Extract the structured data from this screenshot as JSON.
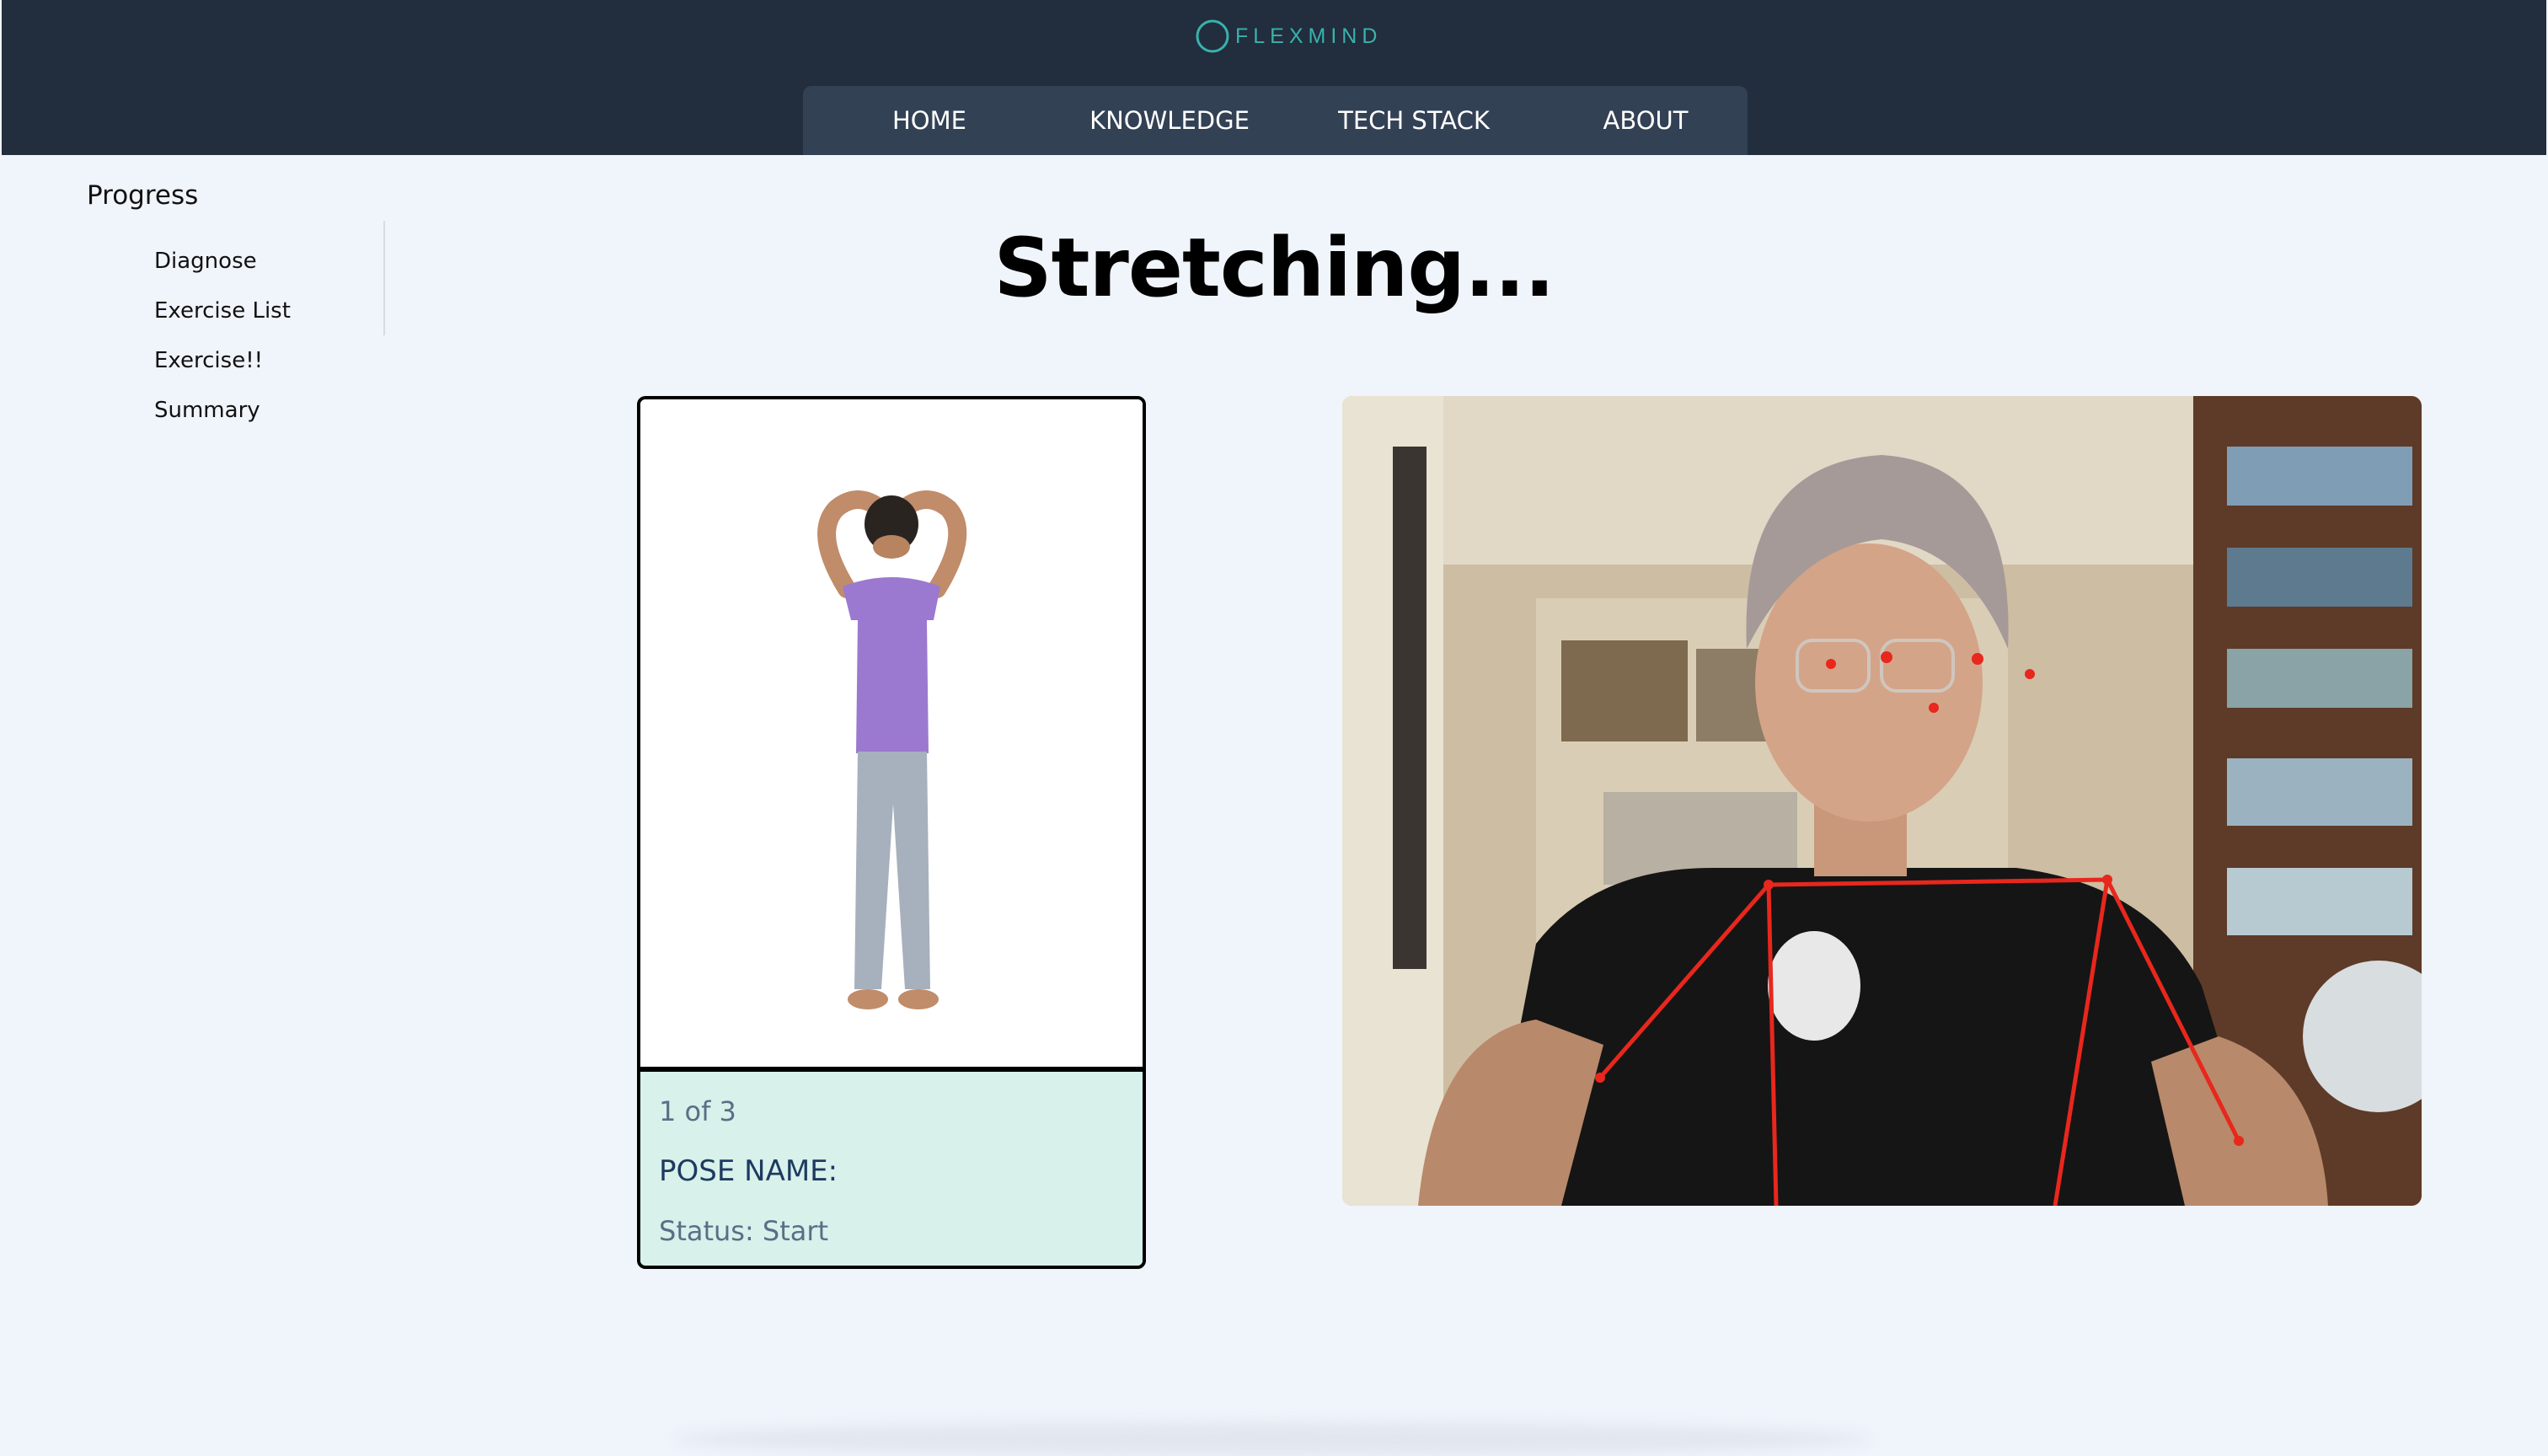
{
  "brand": {
    "name": "FLEXMIND",
    "accent": "#38b2ac"
  },
  "nav": {
    "items": [
      {
        "label": "HOME"
      },
      {
        "label": "KNOWLEDGE"
      },
      {
        "label": "TECH STACK"
      },
      {
        "label": "ABOUT"
      }
    ]
  },
  "sidebar": {
    "title": "Progress",
    "items": [
      {
        "label": "Diagnose"
      },
      {
        "label": "Exercise List"
      },
      {
        "label": "Exercise!!"
      },
      {
        "label": "Summary"
      }
    ]
  },
  "main": {
    "title": "Stretching...",
    "pose_card": {
      "count": "1 of 3",
      "pose_name": "POSE NAME:",
      "status": "Status: Start"
    }
  },
  "colors": {
    "header_bg": "#222d3d",
    "nav_bg": "#334155",
    "page_bg": "#f0f4fb",
    "card_info_bg": "#d8f1eb",
    "pose_overlay": "#e8271d"
  },
  "icons": {
    "logo": "circle-ring-icon"
  }
}
